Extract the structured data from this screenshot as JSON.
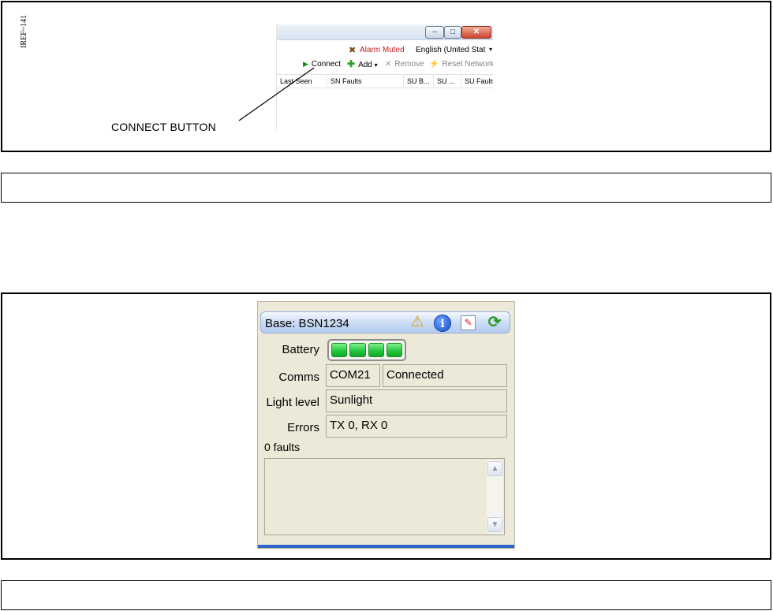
{
  "figure_top": {
    "reference": "IREF~141",
    "callout": "CONNECT BUTTON",
    "window_buttons": {
      "minimize": "–",
      "maximize": "□",
      "close": "✕"
    },
    "alarm": {
      "icon": "alarm-muted-icon",
      "label": "Alarm Muted"
    },
    "language": {
      "value": "English (United Stat",
      "arrow": "▾"
    },
    "toolbar": {
      "connect": "Connect",
      "add": "Add",
      "add_arrow": "▾",
      "remove": "Remove",
      "reset_network": "Reset Network"
    },
    "columns": [
      "Last Seen",
      "SN Faults",
      "SU B...",
      "SU ...",
      "SU Faults"
    ]
  },
  "caption_1": "",
  "figure_bottom": {
    "title": "Base:  BSN1234",
    "icons": [
      "warning-icon",
      "info-icon",
      "edit-icon",
      "refresh-icon"
    ],
    "battery_label": "Battery",
    "battery_cells_filled": 4,
    "battery_cells_total": 4,
    "comms_label": "Comms",
    "comms_port": "COM21",
    "comms_status": "Connected",
    "light_label": "Light level",
    "light_value": "Sunlight",
    "errors_label": "Errors",
    "errors_value": "TX 0, RX 0",
    "faults_label": "0 faults"
  },
  "caption_2": "",
  "colors": {
    "alarm_text": "#c51d1d",
    "battery_green": "#1fc43a",
    "header_blue": "#c9daf4",
    "panel_bg": "#ece9d8"
  }
}
